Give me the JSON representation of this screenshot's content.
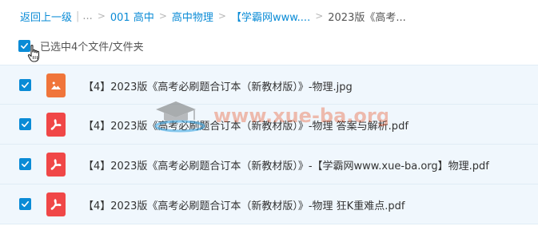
{
  "breadcrumb": {
    "back": "返回上一级",
    "ellipsis": "...",
    "items": [
      "001 高中",
      "高中物理",
      "【学霸网www....",
      "2023版《高考..."
    ]
  },
  "selection": {
    "text": "已选中4个文件/文件夹"
  },
  "files": [
    {
      "name": "【4】2023版《高考必刷题合订本（新教材版）》-物理.jpg",
      "type": "image",
      "checked": true
    },
    {
      "name": "【4】2023版《高考必刷题合订本（新教材版）》-物理 答案与解析.pdf",
      "type": "pdf",
      "checked": true
    },
    {
      "name": "【4】2023版《高考必刷题合订本（新教材版）》-【学霸网www.xue-ba.org】物理.pdf",
      "type": "pdf",
      "checked": true
    },
    {
      "name": "【4】2023版《高考必刷题合订本（新教材版）》-物理 狂K重难点.pdf",
      "type": "pdf",
      "checked": true
    }
  ],
  "watermark": {
    "text": "www.xue-ba.org"
  },
  "colors": {
    "accent": "#0a8bd6",
    "row_bg": "#f0f7fd",
    "pdf_icon": "#f04747",
    "image_icon": "#f0753a",
    "watermark": "#e84a1c"
  },
  "icons": {
    "checkbox": "check-icon",
    "pdf": "pdf-file-icon",
    "image": "image-file-icon",
    "cursor": "hand-cursor-icon"
  }
}
